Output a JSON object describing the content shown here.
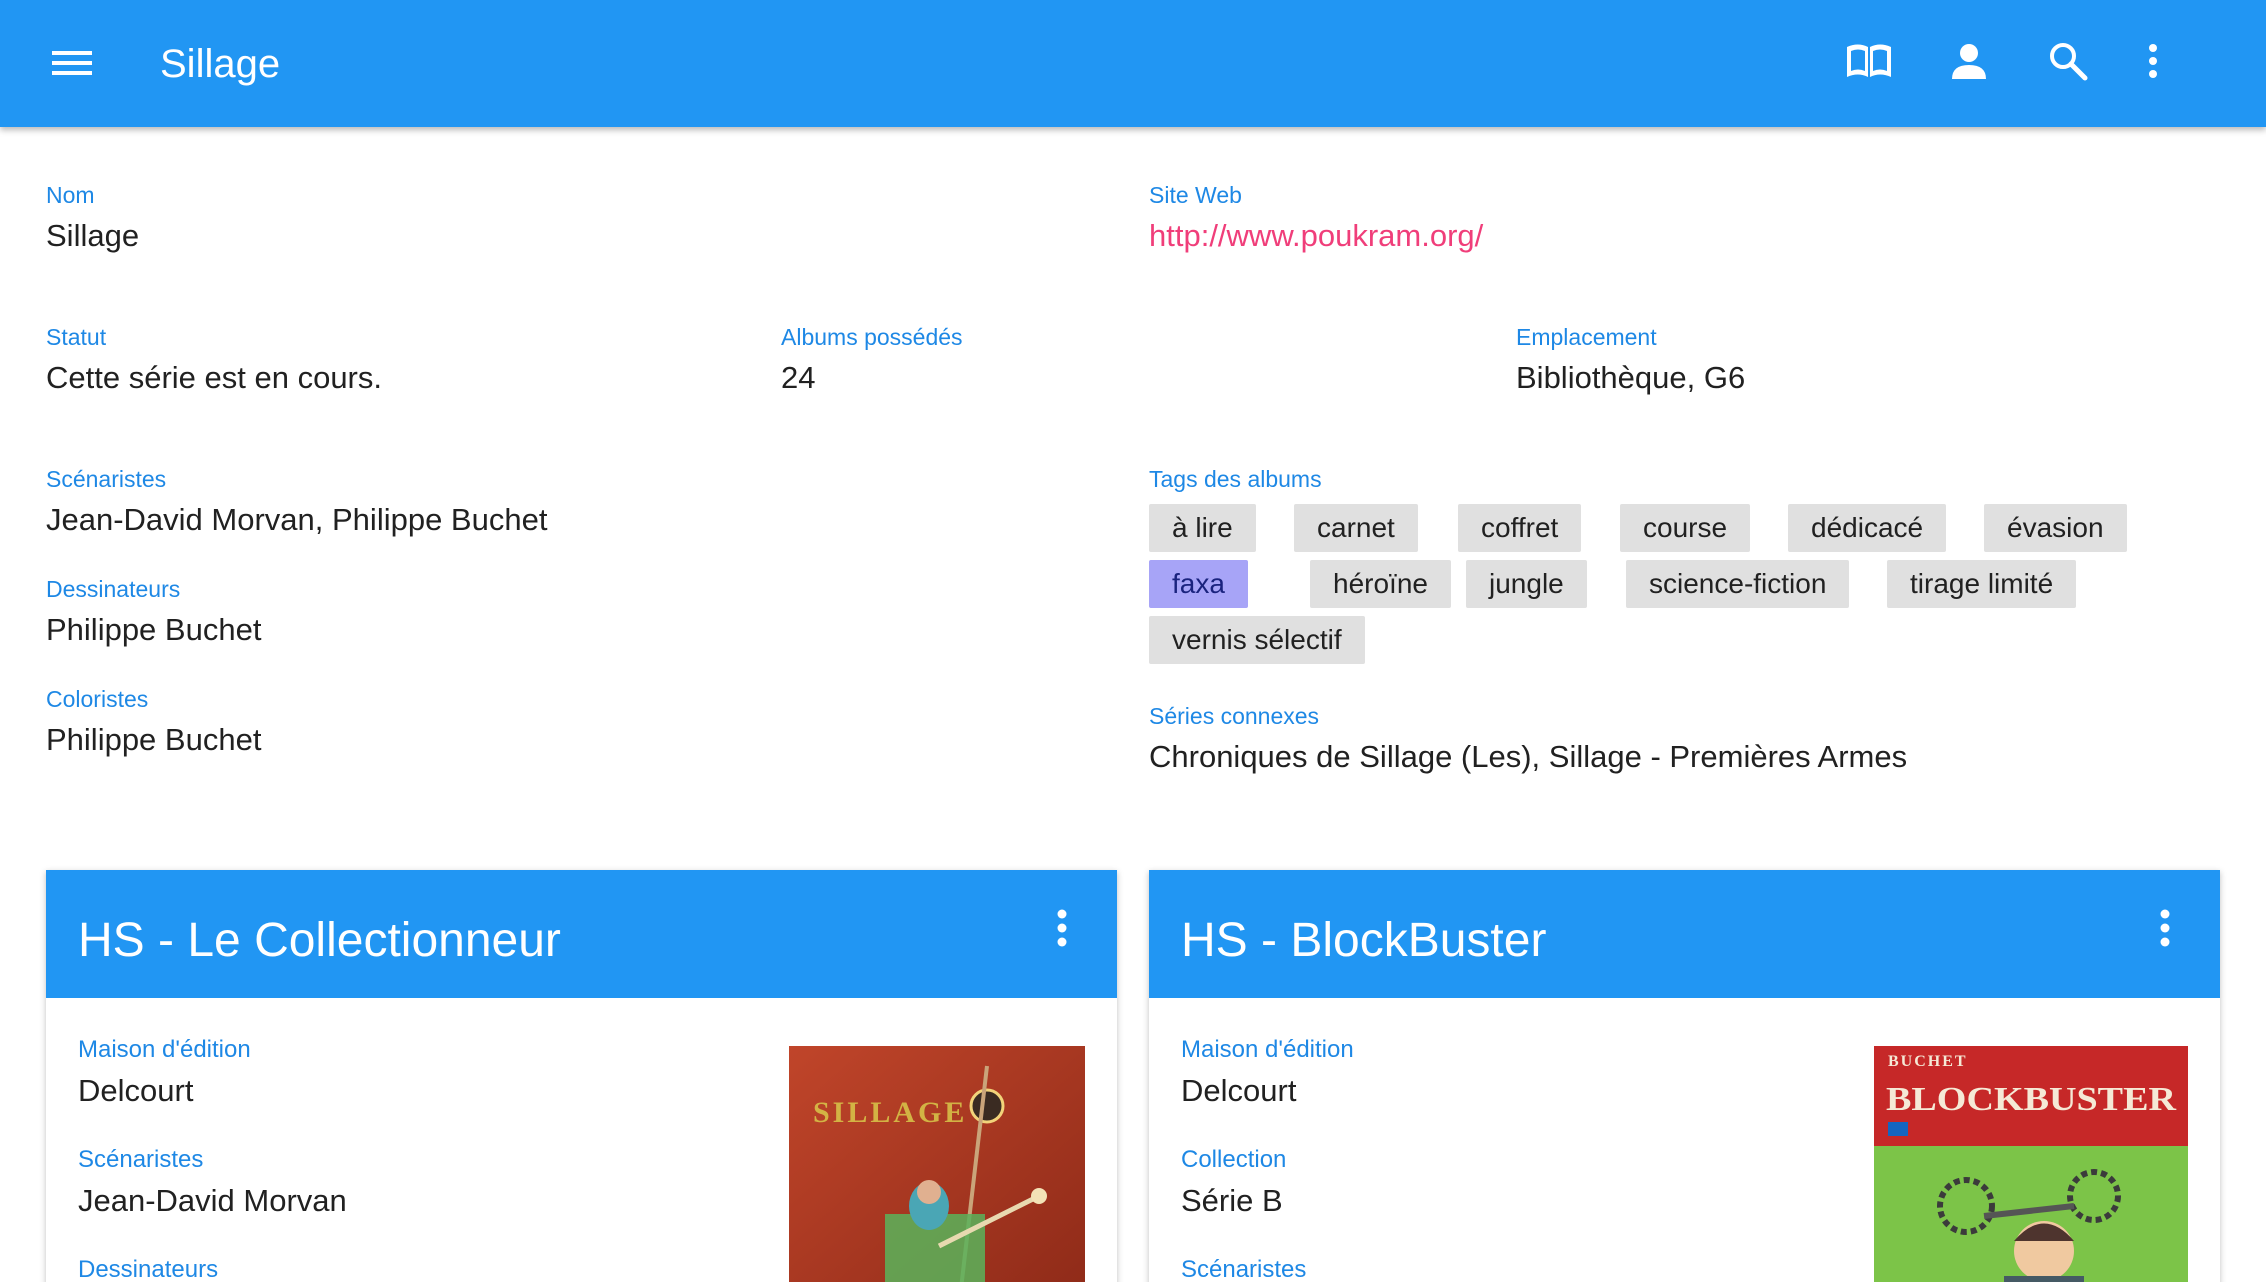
{
  "appbar": {
    "title": "Sillage",
    "icons": [
      "menu-icon",
      "book-icon",
      "person-icon",
      "search-icon",
      "more-vert-icon"
    ]
  },
  "details": {
    "nom": {
      "label": "Nom",
      "value": "Sillage"
    },
    "site": {
      "label": "Site Web",
      "value": "http://www.poukram.org/"
    },
    "statut": {
      "label": "Statut",
      "value": "Cette série est en cours."
    },
    "albums": {
      "label": "Albums possédés",
      "value": "24"
    },
    "emplacement": {
      "label": "Emplacement",
      "value": "Bibliothèque, G6"
    },
    "scenaristes": {
      "label": "Scénaristes",
      "value": "Jean-David Morvan, Philippe Buchet"
    },
    "dessinateurs": {
      "label": "Dessinateurs",
      "value": "Philippe Buchet"
    },
    "coloristes": {
      "label": "Coloristes",
      "value": "Philippe Buchet"
    },
    "tags_label": "Tags des albums",
    "tags": [
      "à lire",
      "carnet",
      "coffret",
      "course",
      "dédicacé",
      "évasion",
      "faxa",
      "héroïne",
      "jungle",
      "science-fiction",
      "tirage limité",
      "vernis sélectif"
    ],
    "active_tag": "faxa",
    "series": {
      "label": "Séries connexes",
      "value": "Chroniques de Sillage (Les), Sillage - Premières Armes"
    }
  },
  "cards": [
    {
      "title": "HS - Le Collectionneur",
      "fields": [
        {
          "label": "Maison d'édition",
          "value": "Delcourt"
        },
        {
          "label": "Scénaristes",
          "value": "Jean-David Morvan"
        },
        {
          "label": "Dessinateurs",
          "value": ""
        }
      ],
      "cover": {
        "logo_text": "SILLAGE",
        "colors": {
          "bg": "#b23a22",
          "accent": "#4caf50"
        }
      }
    },
    {
      "title": "HS - BlockBuster",
      "fields": [
        {
          "label": "Maison d'édition",
          "value": "Delcourt"
        },
        {
          "label": "Collection",
          "value": "Série B"
        },
        {
          "label": "Scénaristes",
          "value": ""
        }
      ],
      "cover": {
        "author_text": "BUCHET",
        "title_text": "BLOCKBUSTER",
        "colors": {
          "bg": "#7cc448",
          "banner": "#c62828"
        }
      }
    }
  ],
  "colors": {
    "primary": "#2196f3",
    "label": "#1e88e5",
    "link": "#f03e7a",
    "chip": "#e0e0e0",
    "chip_active": "#a7a4f7"
  }
}
